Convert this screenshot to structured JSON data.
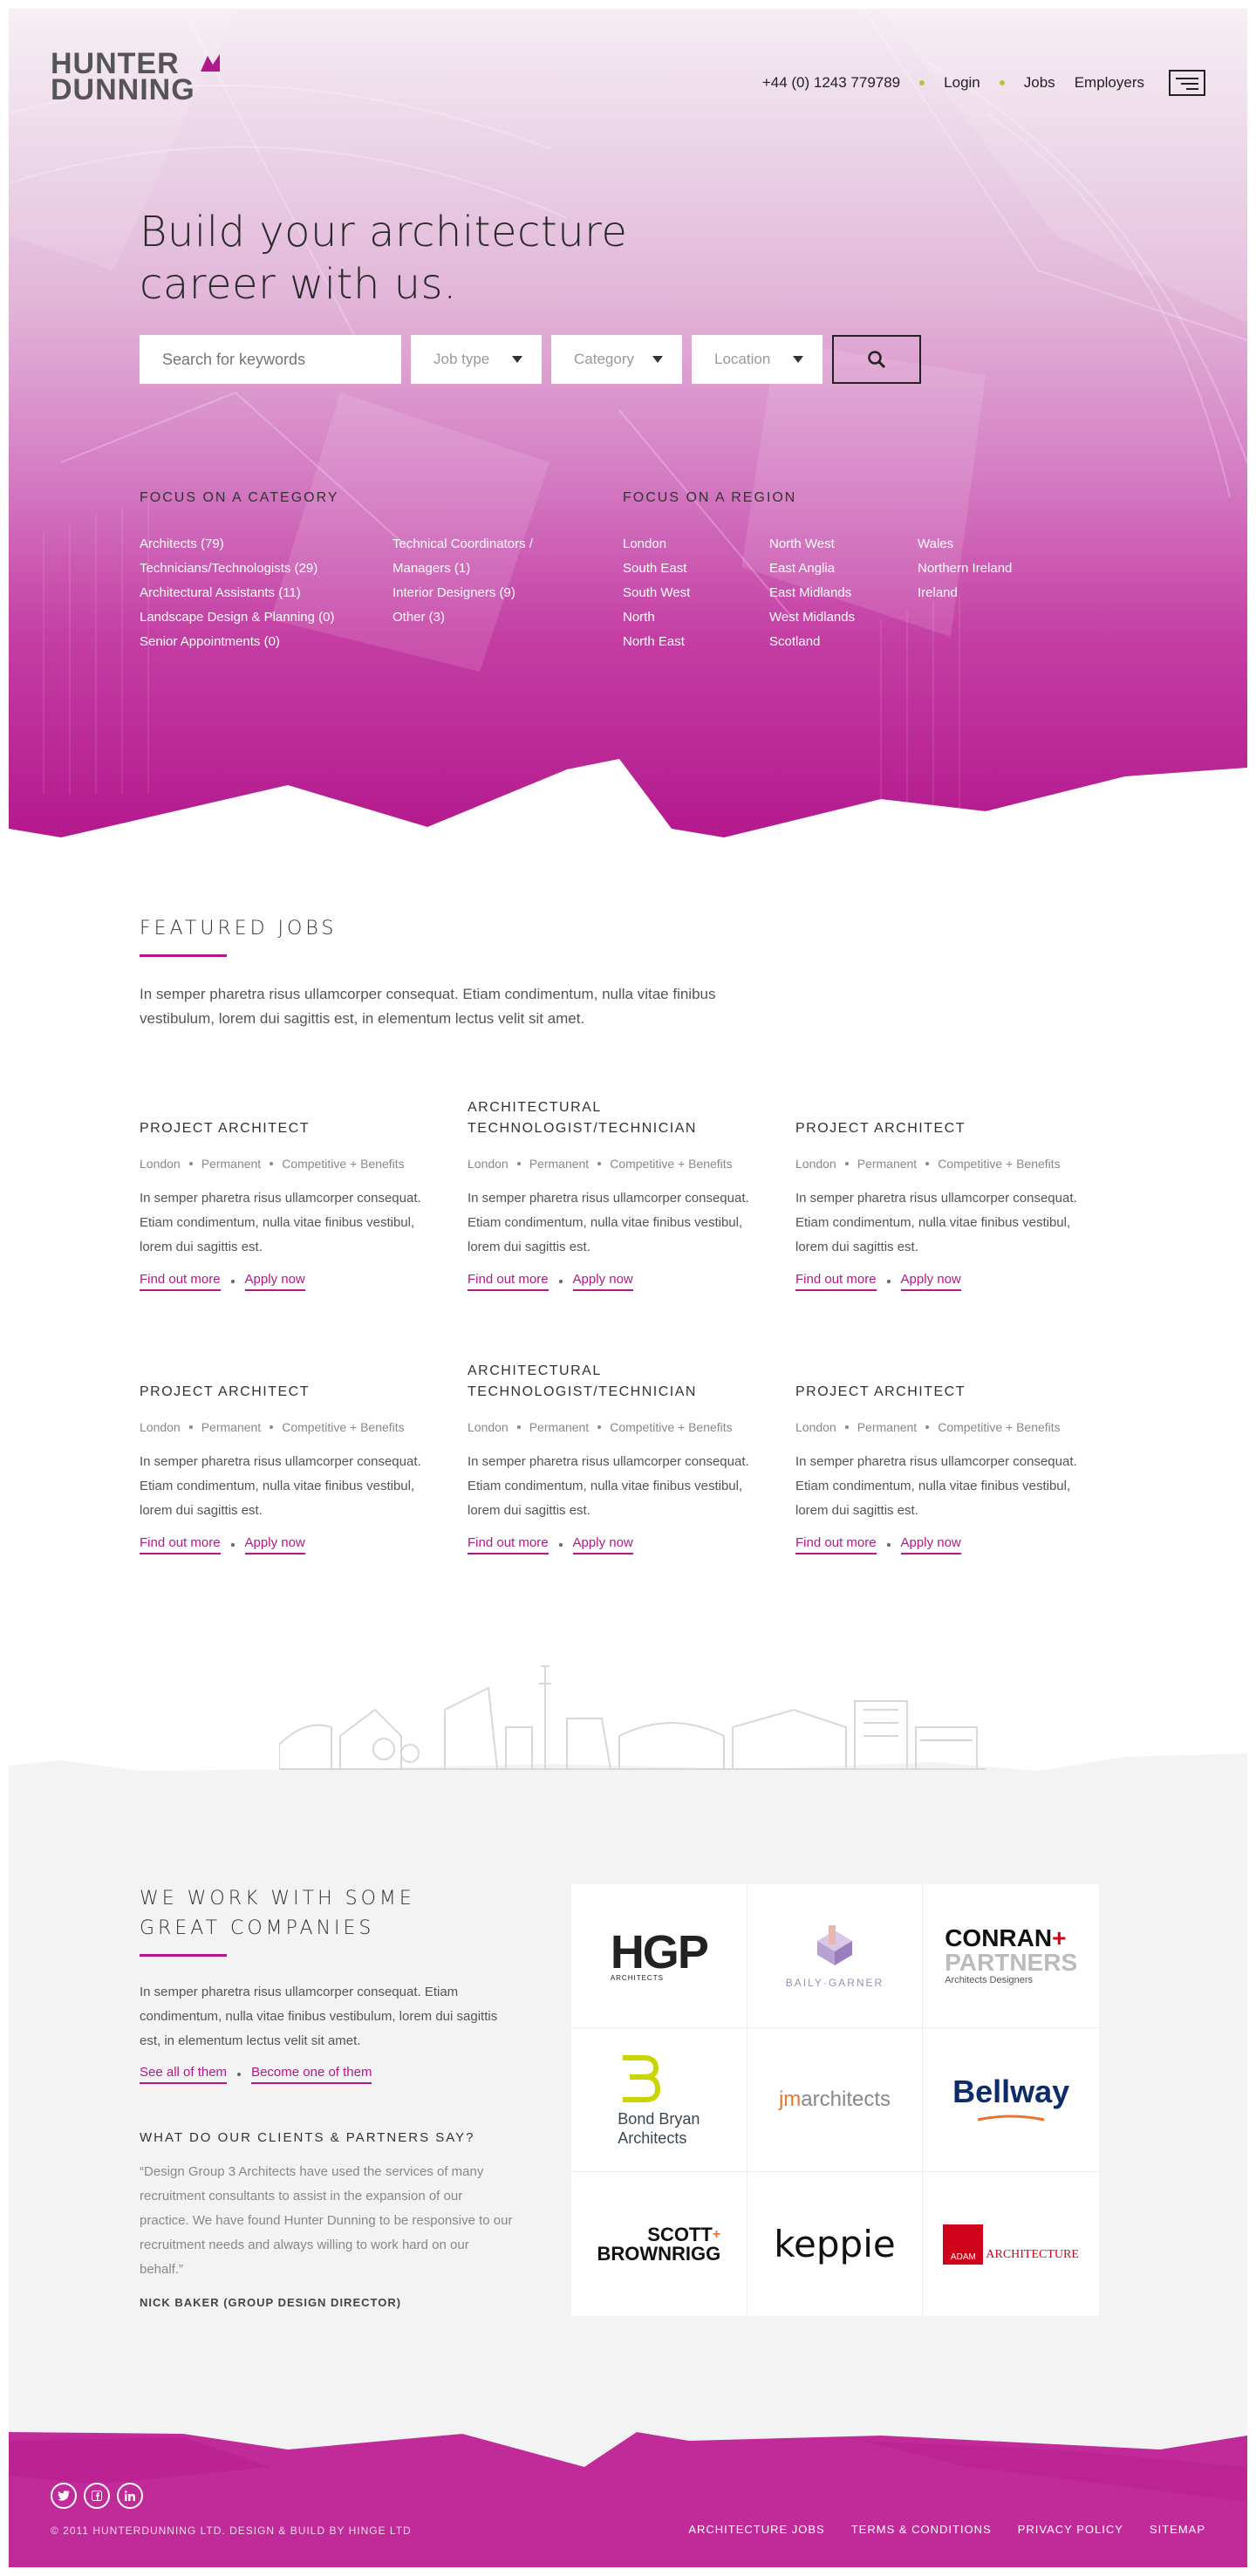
{
  "header": {
    "logo_line1": "HUNTER",
    "logo_line2": "DUNNING",
    "phone": "+44 (0) 1243 779789",
    "nav": [
      "Login",
      "Jobs",
      "Employers"
    ]
  },
  "hero": {
    "title_line1": "Build your architecture",
    "title_line2": "career with us.",
    "search_placeholder": "Search for keywords",
    "filters": [
      "Job type",
      "Category",
      "Location"
    ]
  },
  "focus_category": {
    "title": "FOCUS ON A CATEGORY",
    "col1": [
      "Architects (79)",
      "Technicians/Technologists (29)",
      "Architectural Assistants (11)",
      "Landscape Design & Planning (0)",
      "Senior Appointments (0)"
    ],
    "col2": [
      "Technical Coordinators /",
      "Managers (1)",
      "Interior Designers (9)",
      "Other (3)"
    ]
  },
  "focus_region": {
    "title": "FOCUS ON A REGION",
    "col1": [
      "London",
      "South East",
      "South West",
      "North",
      "North East"
    ],
    "col2": [
      "North West",
      "East Anglia",
      "East Midlands",
      "West Midlands",
      "Scotland"
    ],
    "col3": [
      "Wales",
      "Northern Ireland",
      "Ireland"
    ]
  },
  "featured": {
    "title": "FEATURED JOBS",
    "intro": "In semper pharetra risus ullamcorper consequat. Etiam condimentum, nulla vitae finibus vestibulum, lorem dui sagittis est, in elementum lectus velit sit amet.",
    "jobs": [
      {
        "title": "PROJECT ARCHITECT",
        "location": "London",
        "type": "Permanent",
        "salary": "Competitive + Benefits",
        "desc": "In semper pharetra risus ullamcorper consequat. Etiam condimentum, nulla vitae finibus vestibul, lorem dui sagittis est.",
        "link1": "Find out more",
        "link2": "Apply now"
      },
      {
        "title": "ARCHITECTURAL TECHNOLOGIST/TECHNICIAN",
        "location": "London",
        "type": "Permanent",
        "salary": "Competitive + Benefits",
        "desc": "In semper pharetra risus ullamcorper consequat. Etiam condimentum, nulla vitae finibus vestibul, lorem dui sagittis est.",
        "link1": "Find out more",
        "link2": "Apply now"
      },
      {
        "title": "PROJECT ARCHITECT",
        "location": "London",
        "type": "Permanent",
        "salary": "Competitive + Benefits",
        "desc": "In semper pharetra risus ullamcorper consequat. Etiam condimentum, nulla vitae finibus vestibul, lorem dui sagittis est.",
        "link1": "Find out more",
        "link2": "Apply now"
      },
      {
        "title": "PROJECT ARCHITECT",
        "location": "London",
        "type": "Permanent",
        "salary": "Competitive + Benefits",
        "desc": "In semper pharetra risus ullamcorper consequat. Etiam condimentum, nulla vitae finibus vestibul, lorem dui sagittis est.",
        "link1": "Find out more",
        "link2": "Apply now"
      },
      {
        "title": "ARCHITECTURAL TECHNOLOGIST/TECHNICIAN",
        "location": "London",
        "type": "Permanent",
        "salary": "Competitive + Benefits",
        "desc": "In semper pharetra risus ullamcorper consequat. Etiam condimentum, nulla vitae finibus vestibul, lorem dui sagittis est.",
        "link1": "Find out more",
        "link2": "Apply now"
      },
      {
        "title": "PROJECT ARCHITECT",
        "location": "London",
        "type": "Permanent",
        "salary": "Competitive + Benefits",
        "desc": "In semper pharetra risus ullamcorper consequat. Etiam condimentum, nulla vitae finibus vestibul, lorem dui sagittis est.",
        "link1": "Find out more",
        "link2": "Apply now"
      }
    ]
  },
  "companies": {
    "title_line1": "WE WORK WITH SOME",
    "title_line2": "GREAT COMPANIES",
    "text": "In semper pharetra risus ullamcorper consequat. Etiam condimentum, nulla vitae finibus vestibulum, lorem dui sagittis est, in elementum lectus velit sit amet.",
    "link1": "See all of them",
    "link2": "Become one of them",
    "clients_title": "WHAT DO OUR CLIENTS & PARTNERS SAY?",
    "quote": "“Design Group 3 Architects have used the services of many recruitment consultants to assist in the expansion of our practice. We have found Hunter Dunning to be responsive to our recruitment needs and always willing to work hard on our behalf.”",
    "author": "NICK BAKER (GROUP DESIGN DIRECTOR)",
    "logos": {
      "hgp": "HGP",
      "hgp_sub": "ARCHITECTS",
      "baily": "BAILY·GARNER",
      "conran1": "CONRAN",
      "conran2": "PARTNERS",
      "conran3": "Architects Designers",
      "bondbryan1": "Bond Bryan",
      "bondbryan2": "Architects",
      "jm_prefix": "jm",
      "jm_rest": "architects",
      "bellway": "Bellway",
      "scott1": "SCOTT",
      "scott2": "BROWNRIGG",
      "keppie": "keppie",
      "adam": "ADAM",
      "adam_rest": "ARCHITECTURE"
    }
  },
  "footer": {
    "social": [
      "twitter-icon",
      "facebook-icon",
      "linkedin-icon"
    ],
    "copyright": "© 2011 HUNTERDUNNING LTD.  DESIGN & BUILD BY HINGE LTD",
    "nav": [
      "ARCHITECTURE JOBS",
      "TERMS & CONDITIONS",
      "PRIVACY POLICY",
      "SITEMAP"
    ]
  },
  "colors": {
    "accent": "#b3178c",
    "footer": "#c02b99",
    "dot": "#b4c63a"
  }
}
